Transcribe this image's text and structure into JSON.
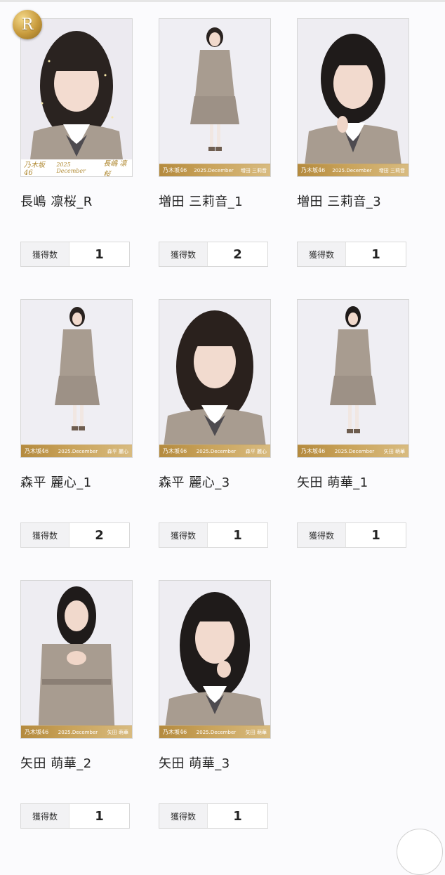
{
  "colors": {
    "background": "#fbfbfd",
    "gold": "#c9a35a",
    "border": "#d9d9d9",
    "label_bg": "#f2f2f4"
  },
  "badge": {
    "label": "R",
    "icon": "rare-gold-badge-icon"
  },
  "count_label": "獲得数",
  "cards": [
    {
      "title": "長嶋 凛桜_R",
      "count": "1",
      "footer_logo": "乃木坂46",
      "footer_date": "2025 December",
      "footer_name": "長嶋 凛桜",
      "rare": true
    },
    {
      "title": "増田 三莉音_1",
      "count": "2",
      "footer_logo": "乃木坂46",
      "footer_date": "2025.December",
      "footer_name": "増田 三莉音",
      "rare": false
    },
    {
      "title": "増田 三莉音_3",
      "count": "1",
      "footer_logo": "乃木坂46",
      "footer_date": "2025.December",
      "footer_name": "増田 三莉音",
      "rare": false
    },
    {
      "title": "森平 麗心_1",
      "count": "2",
      "footer_logo": "乃木坂46",
      "footer_date": "2025.December",
      "footer_name": "森平 麗心",
      "rare": false
    },
    {
      "title": "森平 麗心_3",
      "count": "1",
      "footer_logo": "乃木坂46",
      "footer_date": "2025.December",
      "footer_name": "森平 麗心",
      "rare": false
    },
    {
      "title": "矢田 萌華_1",
      "count": "1",
      "footer_logo": "乃木坂46",
      "footer_date": "2025.December",
      "footer_name": "矢田 萌華",
      "rare": false
    },
    {
      "title": "矢田 萌華_2",
      "count": "1",
      "footer_logo": "乃木坂46",
      "footer_date": "2025.December",
      "footer_name": "矢田 萌華",
      "rare": false
    },
    {
      "title": "矢田 萌華_3",
      "count": "1",
      "footer_logo": "乃木坂46",
      "footer_date": "2025.December",
      "footer_name": "矢田 萌華",
      "rare": false
    }
  ]
}
